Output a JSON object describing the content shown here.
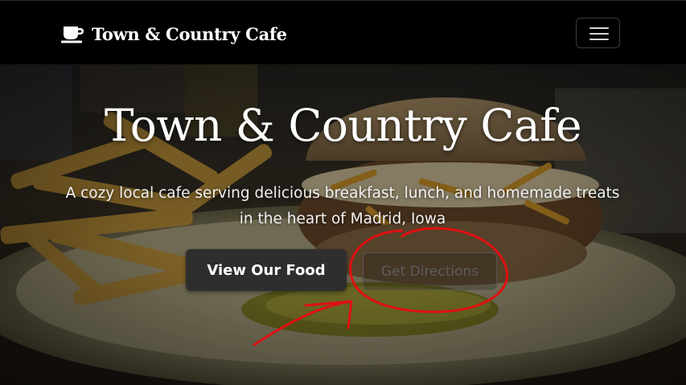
{
  "navbar": {
    "brand_text": "Town & Country Cafe",
    "brand_icon": "coffee-cup-icon",
    "menu_icon": "hamburger-menu-icon"
  },
  "hero": {
    "title": "Town & Country Cafe",
    "subtitle": "A cozy local cafe serving delicious breakfast, lunch, and homemade treats in the heart of Madrid, Iowa",
    "primary_button_label": "View Our Food",
    "secondary_button_label": "Get Directions",
    "background_image": "burger-and-fries-photo"
  },
  "annotation": {
    "color": "#e01010",
    "shape": "red-circle-and-arrow"
  },
  "colors": {
    "navbar_bg": "#000000",
    "text": "#ffffff",
    "primary_button_bg": "#2e2e2e",
    "outline_button_text": "#5c5c5c"
  }
}
